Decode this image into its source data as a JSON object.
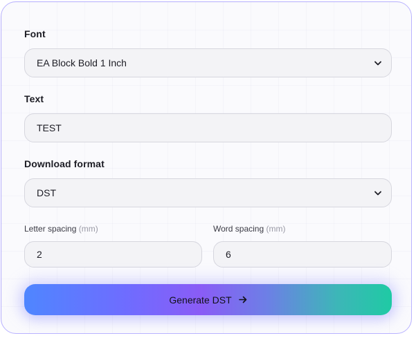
{
  "font": {
    "label": "Font",
    "selected": "EA Block Bold 1 Inch"
  },
  "text": {
    "label": "Text",
    "value": "TEST"
  },
  "download_format": {
    "label": "Download format",
    "selected": "DST"
  },
  "letter_spacing": {
    "label": "Letter spacing",
    "unit": "(mm)",
    "value": "2"
  },
  "word_spacing": {
    "label": "Word spacing",
    "unit": "(mm)",
    "value": "6"
  },
  "generate_button": {
    "label": "Generate DST"
  },
  "colors": {
    "card_border": "#b9b2ff",
    "gradient_start": "#4f86ff",
    "gradient_mid": "#8a5cf6",
    "gradient_end": "#1fcaa4"
  },
  "icons": [
    "chevron-down-icon",
    "arrow-right-icon"
  ]
}
